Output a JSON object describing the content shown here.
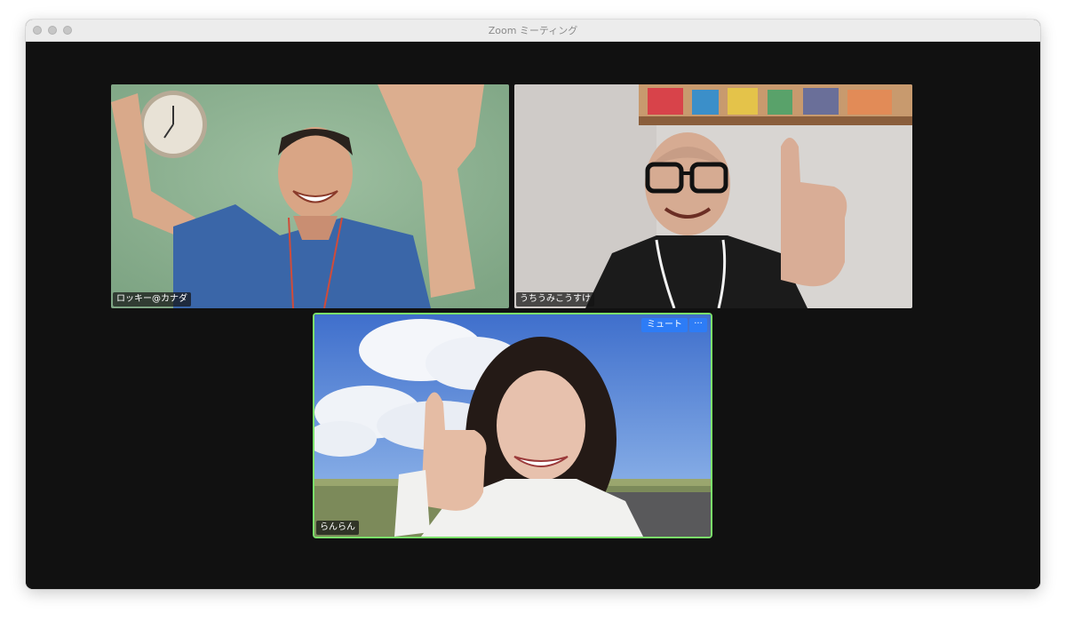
{
  "window": {
    "title": "Zoom ミーティング"
  },
  "participants": [
    {
      "name": "ロッキー@カナダ",
      "background": "green-wall",
      "active_speaker": false
    },
    {
      "name": "うちうみこうすけ",
      "background": "white-wall",
      "active_speaker": false
    },
    {
      "name": "らんらん",
      "background": "blue-sky",
      "active_speaker": true
    }
  ],
  "tile_controls": {
    "mute_label": "ミュート",
    "more_label": "···",
    "more_icon": "ellipsis-icon"
  },
  "colors": {
    "window_bg": "#111111",
    "titlebar_bg": "#ececec",
    "speaker_border": "#7be06a",
    "control_blue": "#2d7cf6"
  }
}
